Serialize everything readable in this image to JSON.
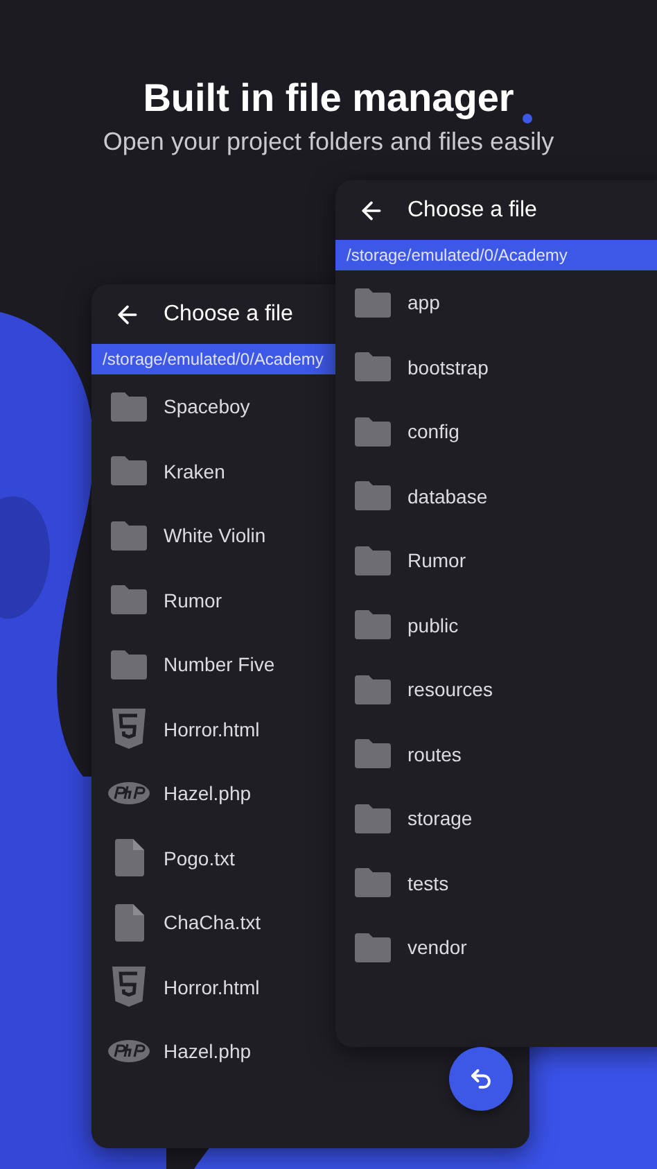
{
  "header": {
    "title": "Built in file manager",
    "subtitle": "Open your project folders and files easily"
  },
  "screens": [
    {
      "title": "Choose a file",
      "path": "/storage/emulated/0/Academy",
      "items": [
        {
          "name": "Spaceboy",
          "kind": "folder"
        },
        {
          "name": "Kraken",
          "kind": "folder"
        },
        {
          "name": "White Violin",
          "kind": "folder"
        },
        {
          "name": "Rumor",
          "kind": "folder"
        },
        {
          "name": "Number Five",
          "kind": "folder"
        },
        {
          "name": "Horror.html",
          "kind": "html"
        },
        {
          "name": "Hazel.php",
          "kind": "php"
        },
        {
          "name": "Pogo.txt",
          "kind": "txt"
        },
        {
          "name": "ChaCha.txt",
          "kind": "txt"
        },
        {
          "name": "Horror.html",
          "kind": "html"
        },
        {
          "name": "Hazel.php",
          "kind": "php"
        }
      ]
    },
    {
      "title": "Choose a file",
      "path": "/storage/emulated/0/Academy",
      "items": [
        {
          "name": "app",
          "kind": "folder"
        },
        {
          "name": "bootstrap",
          "kind": "folder"
        },
        {
          "name": "config",
          "kind": "folder"
        },
        {
          "name": "database",
          "kind": "folder"
        },
        {
          "name": "Rumor",
          "kind": "folder"
        },
        {
          "name": "public",
          "kind": "folder"
        },
        {
          "name": "resources",
          "kind": "folder"
        },
        {
          "name": "routes",
          "kind": "folder"
        },
        {
          "name": "storage",
          "kind": "folder"
        },
        {
          "name": "tests",
          "kind": "folder"
        },
        {
          "name": "vendor",
          "kind": "folder"
        }
      ]
    }
  ]
}
